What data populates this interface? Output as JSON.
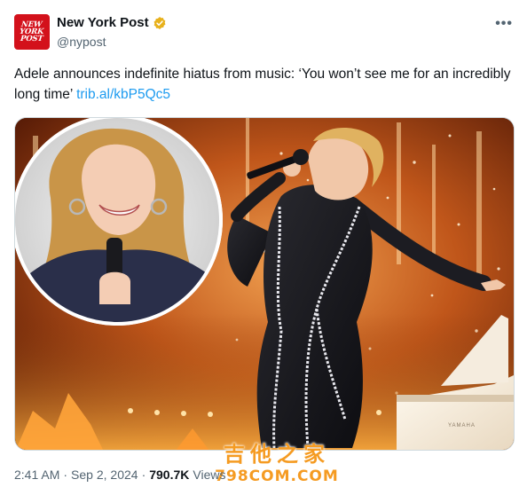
{
  "account": {
    "display_name": "New York Post",
    "handle": "@nypost",
    "avatar_text": [
      "NEW",
      "YORK",
      "POST"
    ],
    "verified": true
  },
  "more_label": "•••",
  "tweet": {
    "text": "Adele announces indefinite hiatus from music: ‘You won’t see me for an incredibly long time’ ",
    "link": "trib.al/kbP5Qc5"
  },
  "media": {
    "description_icons": [
      "performer-photo",
      "inset-portrait",
      "piano"
    ],
    "piano_brand": "YAMAHA"
  },
  "footer": {
    "time": "2:41 AM",
    "separator": "·",
    "date": "Sep 2, 2024",
    "views_count": "790.7K",
    "views_label": "Views"
  },
  "watermark": {
    "line1": "吉他之家",
    "line2": "798COM.COM"
  },
  "colors": {
    "link": "#1d9bf0",
    "brand_red": "#d3111b",
    "verified_gold": "#e8b11c",
    "muted_text": "#536471",
    "watermark": "#f59b22"
  }
}
